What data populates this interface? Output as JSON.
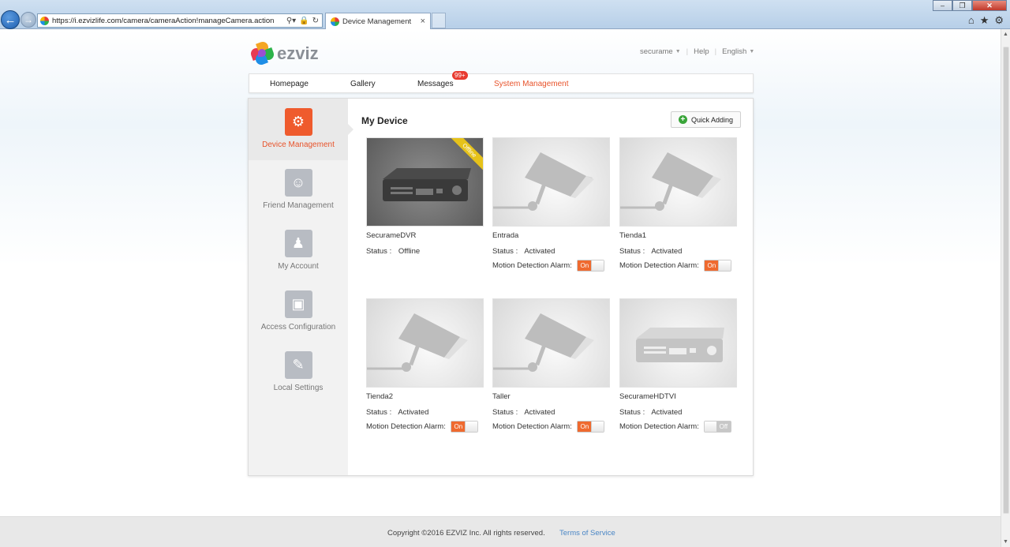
{
  "browser": {
    "url": "https://i.ezvizlife.com/camera/cameraAction!manageCamera.action",
    "tab_title": "Device Management",
    "tab_close": "×",
    "window_buttons": [
      "–",
      "❐",
      "✕"
    ],
    "toolbar_icons": [
      "home-icon",
      "star-icon",
      "gear-icon"
    ]
  },
  "header": {
    "logo_text": "ezviz",
    "user": "securame",
    "help": "Help",
    "language": "English",
    "separator": "|"
  },
  "nav": {
    "items": [
      {
        "label": "Homepage"
      },
      {
        "label": "Gallery"
      },
      {
        "label": "Messages",
        "badge": "99+"
      },
      {
        "label": "System Management",
        "active": true
      }
    ]
  },
  "sidebar": {
    "items": [
      {
        "label": "Device Management",
        "icon": "gear-icon",
        "active": true
      },
      {
        "label": "Friend Management",
        "icon": "friends-icon"
      },
      {
        "label": "My Account",
        "icon": "account-icon"
      },
      {
        "label": "Access Configuration",
        "icon": "monitor-check-icon"
      },
      {
        "label": "Local Settings",
        "icon": "folder-settings-icon"
      }
    ]
  },
  "main": {
    "title": "My Device",
    "quick_adding": "Quick Adding",
    "status_label": "Status :",
    "alarm_label": "Motion Detection Alarm:",
    "devices": [
      {
        "name": "SecurameDVR",
        "type": "dvr",
        "status": "Offline",
        "ribbon": "Offline",
        "alarm": null
      },
      {
        "name": "Entrada",
        "type": "camera",
        "status": "Activated",
        "alarm": "On"
      },
      {
        "name": "Tienda1",
        "type": "camera",
        "status": "Activated",
        "alarm": "On"
      },
      {
        "name": "Tienda2",
        "type": "camera",
        "status": "Activated",
        "alarm": "On"
      },
      {
        "name": "Taller",
        "type": "camera",
        "status": "Activated",
        "alarm": "On"
      },
      {
        "name": "SecurameHDTVI",
        "type": "dvr",
        "status": "Activated",
        "alarm": "Off"
      }
    ]
  },
  "footer": {
    "copyright": "Copyright ©2016 EZVIZ Inc. All rights reserved.",
    "terms": "Terms of Service"
  },
  "colors": {
    "accent": "#ef5b2d",
    "offline_ribbon": "#e6c21a",
    "link": "#4a86c5"
  }
}
